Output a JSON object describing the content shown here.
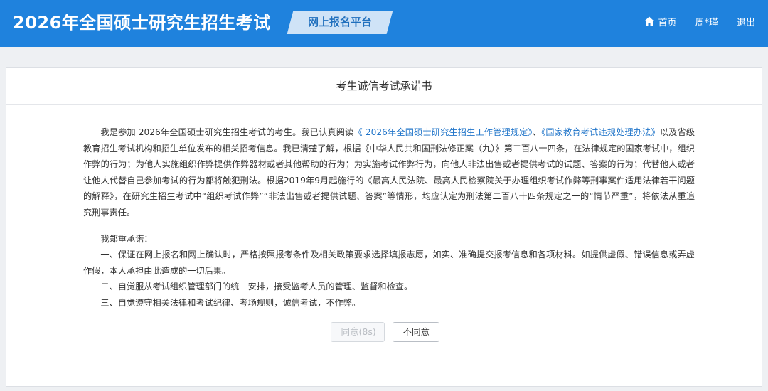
{
  "header": {
    "site_title": "2026年全国硕士研究生招生考试",
    "platform_label": "网上报名平台",
    "nav": {
      "home_icon": "home-icon",
      "home_label": "首页",
      "user_label": "周*瑾",
      "logout_label": "退出"
    }
  },
  "colors": {
    "header_bg": "#1f82dd",
    "badge_bg": "#cfe3f7",
    "badge_text": "#1f6fbd",
    "link": "#1f74c9"
  },
  "pledge_card": {
    "title": "考生诚信考试承诺书",
    "intro": {
      "part1": "我是参加 2026年全国硕士研究生招生考试的考生。我已认真阅读",
      "link1": "《 2026年全国硕士研究生招生工作管理规定》",
      "sep": "、",
      "link2": "《国家教育考试违规处理办法》",
      "part2": "以及省级教育招生考试机构和招生单位发布的相关招考信息。我已清楚了解，根据《中华人民共和国刑法修正案（九）》第二百八十四条，在法律规定的国家考试中，组织作弊的行为；为他人实施组织作弊提供作弊器材或者其他帮助的行为；为实施考试作弊行为，向他人非法出售或者提供考试的试题、答案的行为；代替他人或者让他人代替自己参加考试的行为都将触犯刑法。根据2019年9月起施行的《最高人民法院、最高人民检察院关于办理组织考试作弊等刑事案件适用法律若干问题的解释》，在研究生招生考试中“组织考试作弊”“非法出售或者提供试题、答案”等情形，均应认定为刑法第二百八十四条规定之一的“情节严重”，将依法从重追究刑事责任。"
    },
    "pledge_heading": "我郑重承诺：",
    "pledges": [
      "一、保证在网上报名和网上确认时，严格按照报考条件及相关政策要求选择填报志愿，如实、准确提交报考信息和各项材料。如提供虚假、错误信息或弄虚作假，本人承担由此造成的一切后果。",
      "二、自觉服从考试组织管理部门的统一安排，接受监考人员的管理、监督和检查。",
      "三、自觉遵守相关法律和考试纪律、考场规则，诚信考试，不作弊。"
    ],
    "buttons": {
      "agree_label": "同意(8s)",
      "agree_disabled": true,
      "disagree_label": "不同意"
    }
  }
}
